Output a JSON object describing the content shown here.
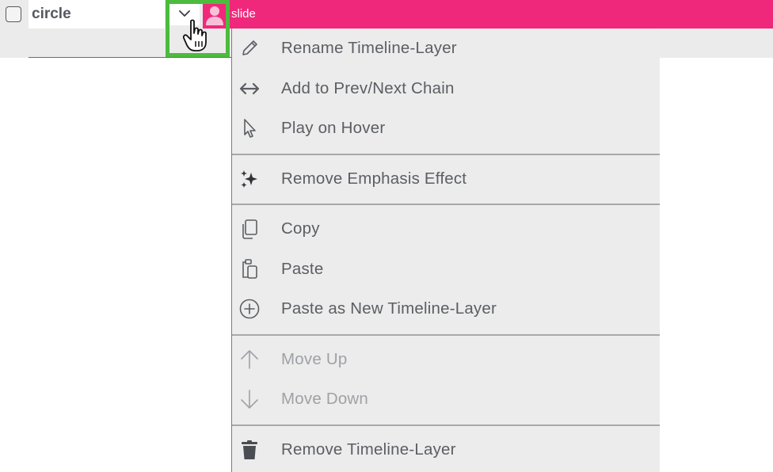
{
  "layer": {
    "name": "circle",
    "clip_label": "slide"
  },
  "colors": {
    "clip_bar": "#f0287b",
    "highlight": "#4cbb3e",
    "menu_bg": "#ececec",
    "text": "#5b5e63",
    "text_disabled": "#9fa1a5"
  },
  "menu": {
    "rename": {
      "label": "Rename Timeline-Layer",
      "icon": "pencil-icon"
    },
    "chain": {
      "label": "Add to Prev/Next Chain",
      "icon": "double-arrow-icon"
    },
    "hover": {
      "label": "Play on Hover",
      "icon": "pointer-icon"
    },
    "emphasis": {
      "label": "Remove Emphasis Effect",
      "icon": "sparkles-icon"
    },
    "copy": {
      "label": "Copy",
      "icon": "copy-icon"
    },
    "paste": {
      "label": "Paste",
      "icon": "clipboard-icon"
    },
    "paste_new": {
      "label": "Paste as New Timeline-Layer",
      "icon": "plus-circle-icon"
    },
    "move_up": {
      "label": "Move Up",
      "icon": "arrow-up-icon",
      "disabled": true
    },
    "move_down": {
      "label": "Move Down",
      "icon": "arrow-down-icon",
      "disabled": true
    },
    "remove": {
      "label": "Remove Timeline-Layer",
      "icon": "trash-icon"
    }
  }
}
